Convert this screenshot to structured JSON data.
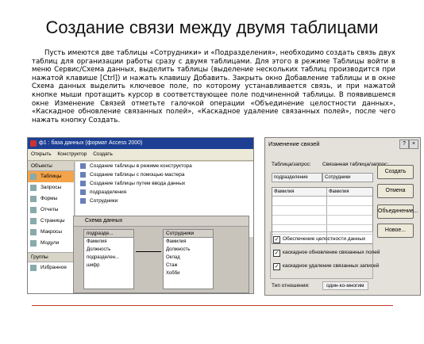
{
  "slide": {
    "title": "Создание связи между двумя таблицами",
    "paragraph": "Пусть имеются две таблицы «Сотрудники» и «Подразделения», необходимо создать связь двух таблиц для организации работы сразу с двумя таблицами. Для этого в режиме Таблицы войти в меню Сервис/Схема данных, выделить таблицы (выделение нескольких таблиц производится при нажатой клавише [Ctrl]) и нажать клавишу Добавить. Закрыть окно Добавление таблицы и в окне Схема данных выделить ключевое поле, по которому устанавливается связь, и при нажатой кнопке мыши протащить курсор в соответствующее поле подчиненной таблицы. В появившемся окне Изменение Связей отметьте галочкой операции «Объединение целостности данных», «Каскадное обновление связанных полей», «Каскадное удаление связанных полей», после чего нажать кнопку Создать."
  },
  "access_window": {
    "title": "ф1 : база данных (формат Access 2000)",
    "toolbar": [
      "Открыть",
      "Конструктор",
      "Создать"
    ],
    "objects_header": "Объекты",
    "objects": [
      "Таблицы",
      "Запросы",
      "Формы",
      "Отчеты",
      "Страницы",
      "Макросы",
      "Модули"
    ],
    "groups_header": "Группы",
    "groups": [
      "Избранное"
    ],
    "main_rows": [
      "Создание таблицы в режиме конструктора",
      "Создание таблицы с помощью мастера",
      "Создание таблицы путем ввода данных",
      "подразделения",
      "Сотрудники"
    ]
  },
  "schema_window": {
    "title": "Схема данных",
    "table1": {
      "name": "подразде...",
      "fields": [
        "Фамилия",
        "Должность",
        "подразделен...",
        "шифр"
      ]
    },
    "table2": {
      "name": "Сотрудники",
      "fields": [
        "Фамилия",
        "Должность",
        "Оклад",
        "Стаж",
        "Хобби"
      ]
    }
  },
  "relation_dialog": {
    "title": "Изменение связей",
    "help": "?",
    "close": "×",
    "table_label": "Таблица/запрос:",
    "related_label": "Связанная таблица/запрос:",
    "table_value": "подразделение",
    "related_value": "Сотрудники",
    "grid_col1": "Фамилия",
    "grid_col2": "Фамилия",
    "buttons": [
      "Создать",
      "Отмена",
      "Объединение...",
      "Новое..."
    ],
    "checks": [
      "Обеспечение целостности данных",
      "каскадное обновление связанных полей",
      "каскадное удаление связанных записей"
    ],
    "reltype_label": "Тип отношения:",
    "reltype_value": "один-ко-многим"
  }
}
